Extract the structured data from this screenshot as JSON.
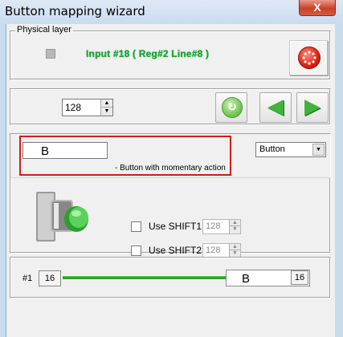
{
  "window": {
    "title": "Button mapping wizard",
    "close_glyph": "X"
  },
  "physical_layer": {
    "legend": "Physical layer",
    "input_info": "Input #18  ( Reg#2   Line#8 )",
    "status_color": "#b8b8b8",
    "reset_icon": "red-reset-icon"
  },
  "navigation": {
    "number_value": "128",
    "refresh_icon": "refresh-icon",
    "back_icon": "left-arrow-icon",
    "forward_icon": "right-arrow-icon",
    "accent_color": "#3fb33a"
  },
  "mapping": {
    "key_value": "B",
    "action_description": "- Button with momentary action",
    "type_selected": "Button",
    "shift1_label": "Use SHIFT1",
    "shift1_value": "128",
    "shift2_label": "Use SHIFT2",
    "shift2_value": "128",
    "highlight_color": "#d21c1c"
  },
  "line_mapping": {
    "prefix": "#1",
    "left_value": "16",
    "key_value": "B",
    "right_value": "16"
  },
  "icons": {
    "spin_up": "▲",
    "spin_down": "▼",
    "dropdown": "▼",
    "refresh_glyph": "↻",
    "back_glyph": "◀",
    "forward_glyph": "▶"
  }
}
